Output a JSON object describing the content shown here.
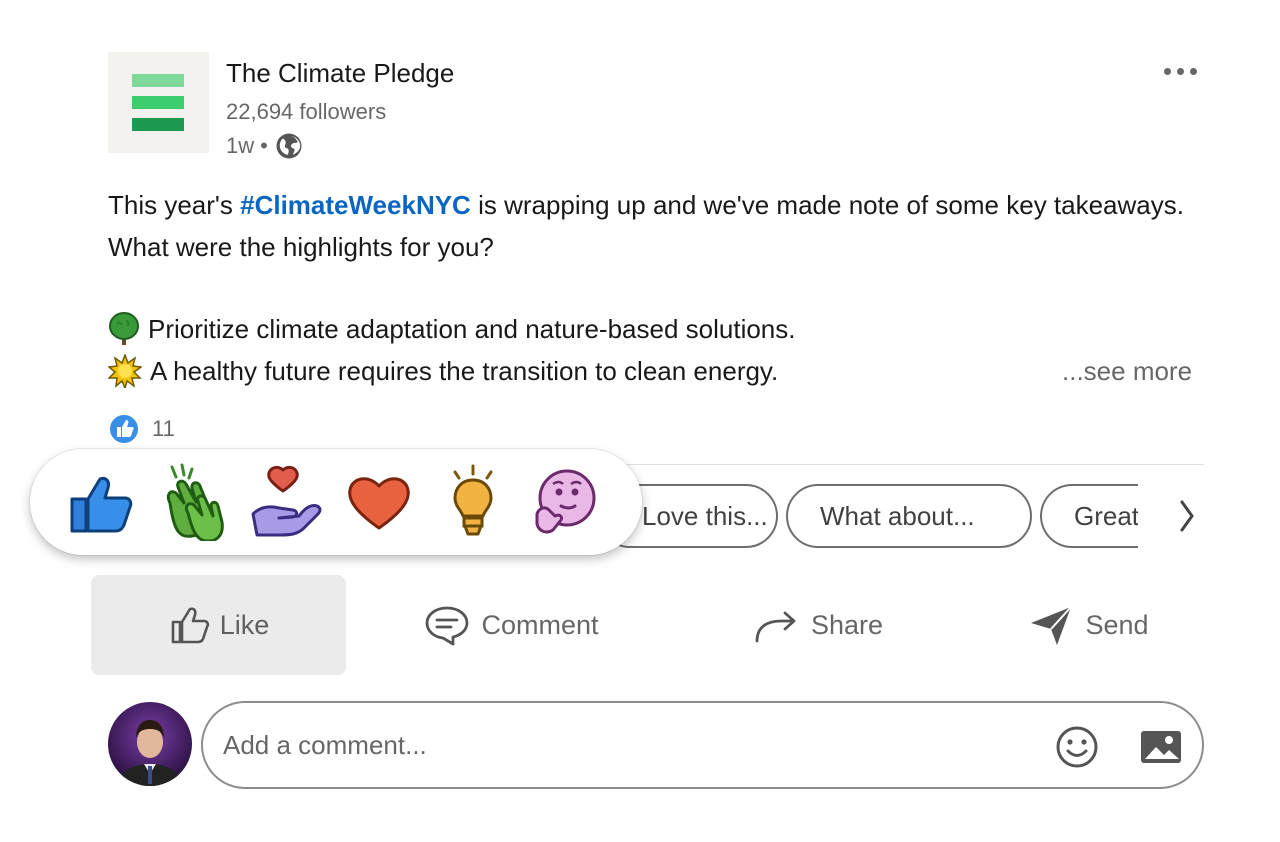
{
  "post": {
    "author": {
      "name": "The Climate Pledge",
      "followers": "22,694 followers",
      "time": "1w",
      "separator": "•",
      "logo_colors": [
        "#7ed89a",
        "#3dcf6e",
        "#1d9a52"
      ]
    },
    "text": {
      "intro_before": "This year's ",
      "hashtag": "#ClimateWeekNYC",
      "intro_after": " is wrapping up and we've made note of some key takeaways. What were the highlights for you?",
      "bullets": [
        {
          "icon": "tree-icon",
          "text": "Prioritize climate adaptation and nature-based solutions."
        },
        {
          "icon": "sun-icon",
          "text": "A healthy future requires the transition to clean energy."
        }
      ],
      "see_more": "...see more"
    },
    "reactions": {
      "count": "11",
      "icon": "like-reaction-icon"
    }
  },
  "reaction_picker": [
    {
      "name": "Like",
      "icon": "thumbs-up-icon"
    },
    {
      "name": "Celebrate",
      "icon": "clapping-hands-icon"
    },
    {
      "name": "Support",
      "icon": "hand-heart-icon"
    },
    {
      "name": "Love",
      "icon": "heart-icon"
    },
    {
      "name": "Insightful",
      "icon": "lightbulb-icon"
    },
    {
      "name": "Funny",
      "icon": "thinking-face-icon"
    }
  ],
  "suggestions": {
    "chips": [
      "Love this...",
      "What about...",
      "Great"
    ],
    "next_icon": "chevron-right-icon"
  },
  "actions": [
    {
      "label": "Like",
      "icon": "like-icon"
    },
    {
      "label": "Comment",
      "icon": "comment-icon"
    },
    {
      "label": "Share",
      "icon": "share-icon"
    },
    {
      "label": "Send",
      "icon": "send-icon"
    }
  ],
  "comment": {
    "placeholder": "Add a comment...",
    "emoji_icon": "emoji-icon",
    "image_icon": "image-icon"
  },
  "colors": {
    "link": "#0a66c2",
    "muted_text": "#666666",
    "active_action_bg": "#ebebeb",
    "like_blue": "#378fe9"
  }
}
